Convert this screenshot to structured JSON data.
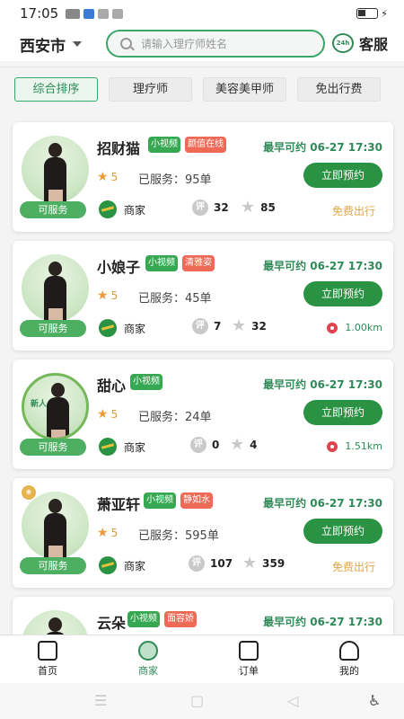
{
  "status_bar": {
    "time": "17:05"
  },
  "header": {
    "city": "西安市",
    "search_placeholder": "请输入理疗师姓名",
    "service_label": "客服",
    "service_icon_text": "24h"
  },
  "filters": [
    {
      "label": "综合排序",
      "active": true
    },
    {
      "label": "理疗师",
      "active": false
    },
    {
      "label": "美容美甲师",
      "active": false
    },
    {
      "label": "免出行费",
      "active": false
    }
  ],
  "cards": [
    {
      "name": "招财猫",
      "tag1": "小视频",
      "tag2": "颜值在线",
      "earliest": "最早可约 06-27 17:30",
      "rating": "5",
      "served": "已服务：95单",
      "book_label": "立即预约",
      "available": "可服务",
      "shop": "商家",
      "review_count": "32",
      "fav_count": "85",
      "extra": "免费出行"
    },
    {
      "name": "小娘子",
      "tag1": "小视频",
      "tag2": "清雅姿",
      "earliest": "最早可约 06-27 17:30",
      "rating": "5",
      "served": "已服务：45单",
      "book_label": "立即预约",
      "available": "可服务",
      "shop": "商家",
      "review_count": "7",
      "fav_count": "32",
      "extra": "1.00km"
    },
    {
      "name": "甜心",
      "tag1": "小视频",
      "badge": "新人",
      "earliest": "最早可约 06-27 17:30",
      "rating": "5",
      "served": "已服务：24单",
      "book_label": "立即预约",
      "available": "可服务",
      "shop": "商家",
      "review_count": "0",
      "fav_count": "4",
      "extra": "1.51km"
    },
    {
      "name": "萧亚轩",
      "tag1": "小视频",
      "tag2": "静如水",
      "earliest": "最早可约 06-27 17:30",
      "rating": "5",
      "served": "已服务：595单",
      "book_label": "立即预约",
      "available": "可服务",
      "shop": "商家",
      "review_count": "107",
      "fav_count": "359",
      "extra": "免费出行"
    },
    {
      "name": "云朵",
      "tag1": "小视频",
      "tag2": "面容娇",
      "earliest": "最早可约 06-27 17:30"
    }
  ],
  "review_icon_text": "评",
  "tabbar": [
    {
      "label": "首页",
      "active": false
    },
    {
      "label": "商家",
      "active": true
    },
    {
      "label": "订单",
      "active": false
    },
    {
      "label": "我的",
      "active": false
    }
  ],
  "colors": {
    "accent": "#2a9343",
    "tag_green": "#36a852",
    "tag_red": "#ee6a57",
    "free_travel": "#e2a64a"
  }
}
